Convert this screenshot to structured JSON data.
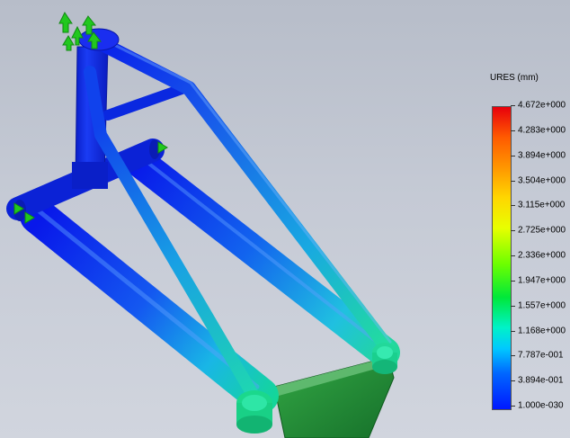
{
  "legend": {
    "title": "URES (mm)",
    "values": [
      "4.672e+000",
      "4.283e+000",
      "3.894e+000",
      "3.504e+000",
      "3.115e+000",
      "2.725e+000",
      "2.336e+000",
      "1.947e+000",
      "1.557e+000",
      "1.168e+000",
      "7.787e-001",
      "3.894e-001",
      "1.000e-030"
    ]
  },
  "colors": {
    "background": "#c5cad5",
    "min": "#0018ff",
    "max": "#e8000c",
    "fixture": "#22c81e",
    "plate": "#1f8a2c"
  }
}
